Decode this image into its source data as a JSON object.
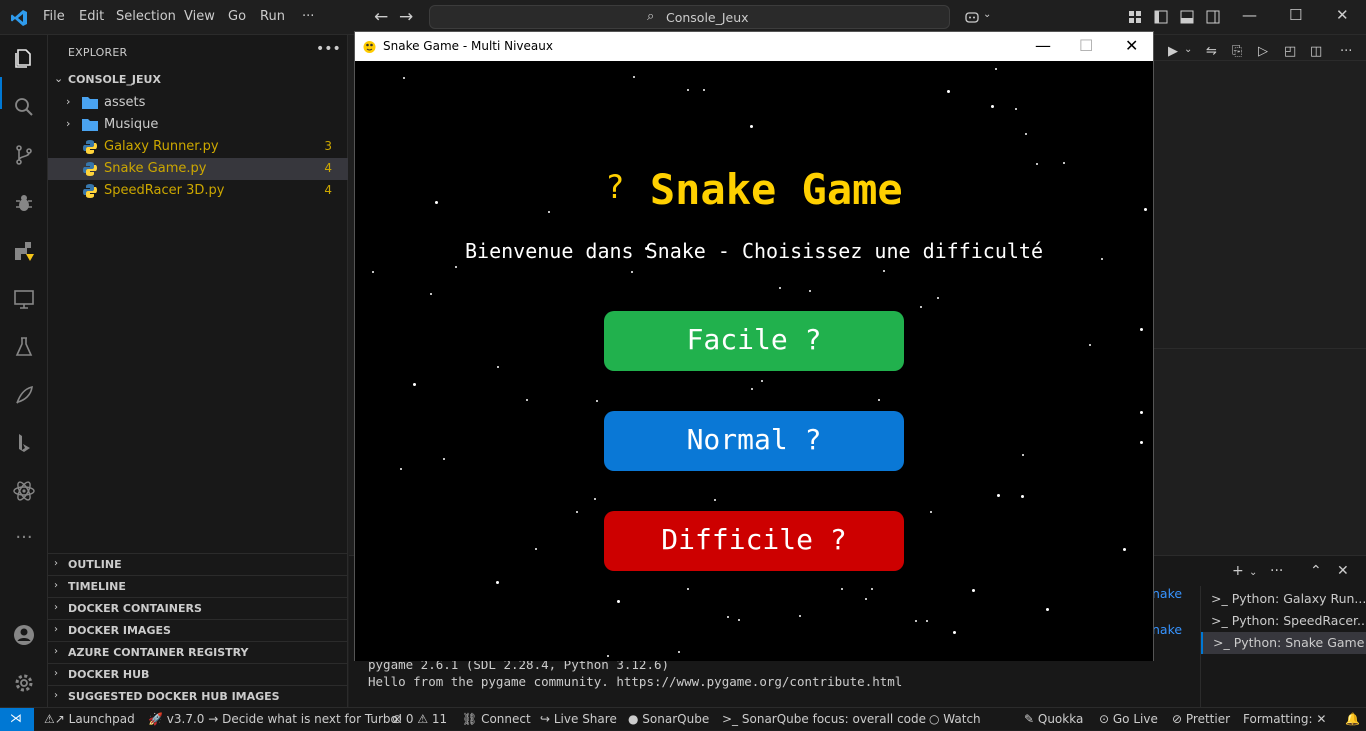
{
  "titlebar": {
    "menu": [
      "File",
      "Edit",
      "Selection",
      "View",
      "Go",
      "Run",
      "···"
    ],
    "command_center": "Console_Jeux"
  },
  "explorer": {
    "title": "EXPLORER",
    "more": "•••",
    "root": "CONSOLE_JEUX",
    "items": [
      {
        "label": "assets",
        "type": "folder"
      },
      {
        "label": "Musique",
        "type": "folder"
      },
      {
        "label": "Galaxy Runner.py",
        "type": "python",
        "problems": "3"
      },
      {
        "label": "Snake Game.py",
        "type": "python",
        "problems": "4"
      },
      {
        "label": "SpeedRacer 3D.py",
        "type": "python",
        "problems": "4"
      }
    ],
    "sections": [
      "OUTLINE",
      "TIMELINE",
      "DOCKER CONTAINERS",
      "DOCKER IMAGES",
      "AZURE CONTAINER REGISTRY",
      "DOCKER HUB",
      "SUGGESTED DOCKER HUB IMAGES"
    ]
  },
  "terminal": {
    "lines": [
      "pygame 2.6.1 (SDL 2.28.4, Python 3.12.6)",
      "Hello from the pygame community. https://www.pygame.org/contribute.html"
    ],
    "fragment1": "nake",
    "fragment2": "nake",
    "list": [
      "Python: Galaxy Run...",
      "Python: SpeedRacer...",
      "Python: Snake Game"
    ]
  },
  "statusbar": {
    "launchpad": "Launchpad",
    "turbo": "v3.7.0 → Decide what is next for Turbo!",
    "errors": "0",
    "warnings": "11",
    "connect": "Connect",
    "liveshare": "Live Share",
    "sonarqube": "SonarQube",
    "sonar_focus": "SonarQube focus: overall code",
    "watch": "Watch",
    "quokka": "Quokka",
    "golive": "Go Live",
    "prettier": "Prettier",
    "formatting": "Formatting: ✕"
  },
  "game": {
    "window_title": "Snake Game - Multi Niveaux",
    "heading_glyph": "?",
    "heading": "Snake Game",
    "subtitle": "Bienvenue dans Snake - Choisissez une difficulté",
    "buttons": {
      "easy": "Facile ?",
      "normal": "Normal ?",
      "hard": "Difficile ?"
    },
    "colors": {
      "heading": "#ffd000",
      "easy": "#21b14d",
      "normal": "#0a78d6",
      "hard": "#cd0000"
    }
  },
  "colors": {
    "accent": "#0078d4",
    "problems": "#cca700"
  }
}
